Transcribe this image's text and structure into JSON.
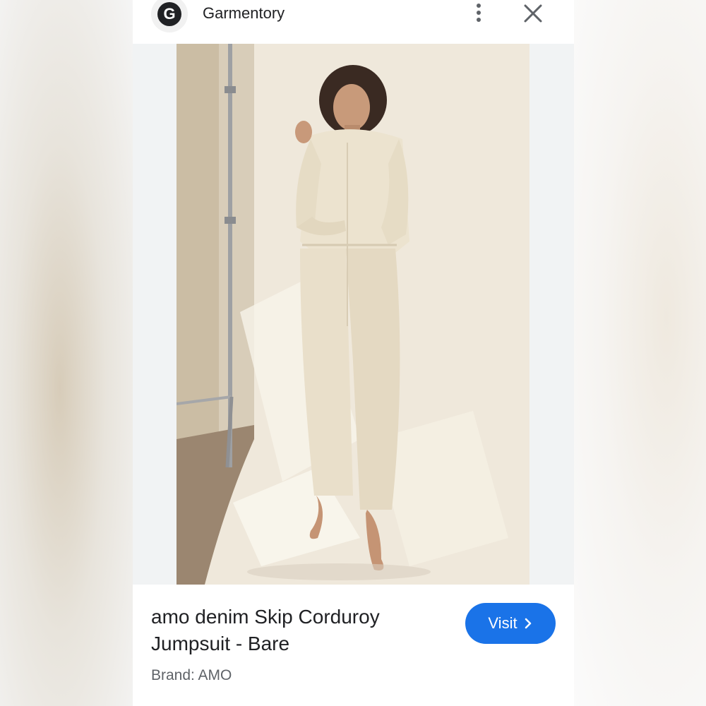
{
  "header": {
    "logo_letter": "G",
    "site_name": "Garmentory"
  },
  "image": {
    "icon": "product-photo",
    "description_visible": false
  },
  "product": {
    "title_line1": "amo denim Skip Corduroy",
    "title_line2": "Jumpsuit - Bare",
    "brand": "Brand: AMO"
  },
  "actions": {
    "visit_label": "Visit",
    "more_icon": "more-vert-icon",
    "close_icon": "close-icon",
    "chevron_icon": "chevron-right-icon"
  },
  "colors": {
    "accent": "#1a73e8",
    "text": "#202124",
    "muted": "#5f6368"
  }
}
